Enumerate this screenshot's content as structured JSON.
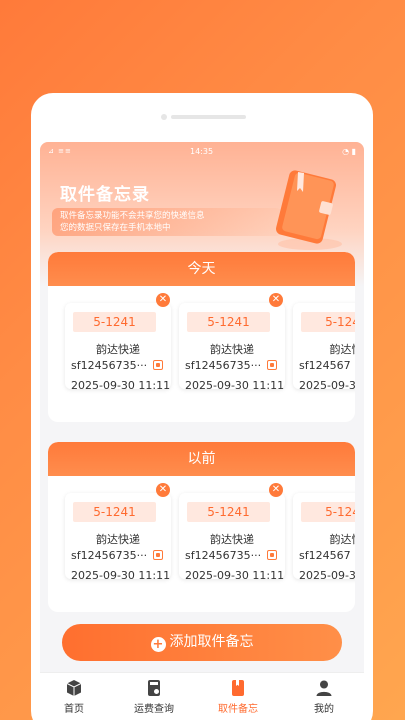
{
  "status_bar": {
    "left": "⊿ ≡≡",
    "time": "14:35",
    "right": "◔ ▮"
  },
  "hero": {
    "title": "取件备忘录",
    "desc_line1": "取件备忘录功能不会共享您的快递信息",
    "desc_line2": "您的数据只保存在手机本地中"
  },
  "sections": [
    {
      "title": "今天",
      "cards": [
        {
          "code": "5-1241",
          "courier": "韵达快递",
          "tracking": "sf12456735···",
          "date": "2025-09-30 11:11"
        },
        {
          "code": "5-1241",
          "courier": "韵达快递",
          "tracking": "sf12456735···",
          "date": "2025-09-30 11:11"
        },
        {
          "code": "5-124",
          "courier": "韵达快",
          "tracking": "sf124567",
          "date": "2025-09-3"
        }
      ]
    },
    {
      "title": "以前",
      "cards": [
        {
          "code": "5-1241",
          "courier": "韵达快递",
          "tracking": "sf12456735···",
          "date": "2025-09-30 11:11"
        },
        {
          "code": "5-1241",
          "courier": "韵达快递",
          "tracking": "sf12456735···",
          "date": "2025-09-30 11:11"
        },
        {
          "code": "5-124",
          "courier": "韵达快",
          "tracking": "sf124567",
          "date": "2025-09-3"
        }
      ]
    }
  ],
  "add_button": {
    "label": "添加取件备忘"
  },
  "tabbar": {
    "items": [
      {
        "label": "首页",
        "icon": "box-icon"
      },
      {
        "label": "运费查询",
        "icon": "calculator-icon"
      },
      {
        "label": "取件备忘",
        "icon": "book-icon",
        "active": true
      },
      {
        "label": "我的",
        "icon": "user-icon"
      }
    ]
  },
  "colors": {
    "accent": "#ff7a3a",
    "code_bg": "#ffe8df",
    "background": "#f5f5f7"
  }
}
